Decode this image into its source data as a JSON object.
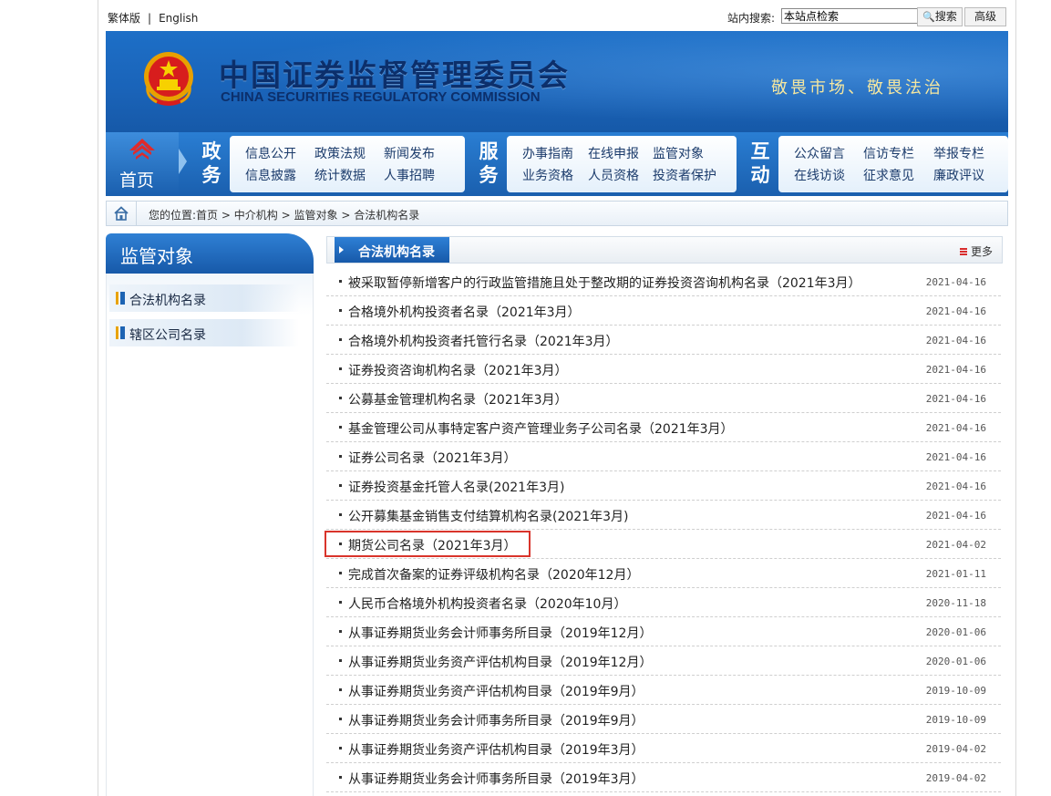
{
  "topbar": {
    "traditional": "繁体版",
    "separator": "|",
    "english": "English",
    "search_label": "站内搜索:",
    "search_value": "本站点检索",
    "search_button": "搜索",
    "advanced_button": "高级"
  },
  "banner": {
    "cn_title": "中国证券监督管理委员会",
    "en_title": "CHINA SECURITIES REGULATORY COMMISSION",
    "slogan": "敬畏市场、敬畏法治"
  },
  "nav": {
    "home": "首页",
    "groups": [
      {
        "t1": "政",
        "t2": "务",
        "links": [
          "信息公开",
          "政策法规",
          "新闻发布",
          "信息披露",
          "统计数据",
          "人事招聘"
        ]
      },
      {
        "t1": "服",
        "t2": "务",
        "links": [
          "办事指南",
          "在线申报",
          "监管对象",
          "业务资格",
          "人员资格",
          "投资者保护"
        ]
      },
      {
        "t1": "互",
        "t2": "动",
        "links": [
          "公众留言",
          "信访专栏",
          "举报专栏",
          "在线访谈",
          "征求意见",
          "廉政评议"
        ]
      }
    ]
  },
  "breadcrumb": {
    "prefix": "您的位置:",
    "items": [
      "首页",
      "中介机构",
      "监管对象",
      "合法机构名录"
    ],
    "sep": ">"
  },
  "sidebar": {
    "title": "监管对象",
    "items": [
      "合法机构名录",
      "辖区公司名录"
    ]
  },
  "main": {
    "tab_title": "合法机构名录",
    "more": "更多",
    "items": [
      {
        "title": "被采取暂停新增客户的行政监管措施且处于整改期的证券投资咨询机构名录（2021年3月）",
        "date": "2021-04-16"
      },
      {
        "title": "合格境外机构投资者名录（2021年3月）",
        "date": "2021-04-16"
      },
      {
        "title": "合格境外机构投资者托管行名录（2021年3月）",
        "date": "2021-04-16"
      },
      {
        "title": "证券投资咨询机构名录（2021年3月）",
        "date": "2021-04-16"
      },
      {
        "title": "公募基金管理机构名录（2021年3月）",
        "date": "2021-04-16"
      },
      {
        "title": "基金管理公司从事特定客户资产管理业务子公司名录（2021年3月）",
        "date": "2021-04-16"
      },
      {
        "title": "证券公司名录（2021年3月）",
        "date": "2021-04-16"
      },
      {
        "title": "证券投资基金托管人名录(2021年3月)",
        "date": "2021-04-16"
      },
      {
        "title": "公开募集基金销售支付结算机构名录(2021年3月)",
        "date": "2021-04-16"
      },
      {
        "title": "期货公司名录（2021年3月）",
        "date": "2021-04-02"
      },
      {
        "title": "完成首次备案的证券评级机构名录（2020年12月）",
        "date": "2021-01-11"
      },
      {
        "title": "人民币合格境外机构投资者名录（2020年10月）",
        "date": "2020-11-18"
      },
      {
        "title": "从事证券期货业务会计师事务所目录（2019年12月）",
        "date": "2020-01-06"
      },
      {
        "title": "从事证券期货业务资产评估机构目录（2019年12月）",
        "date": "2020-01-06"
      },
      {
        "title": "从事证券期货业务资产评估机构目录（2019年9月）",
        "date": "2019-10-09"
      },
      {
        "title": "从事证券期货业务会计师事务所目录（2019年9月）",
        "date": "2019-10-09"
      },
      {
        "title": "从事证券期货业务资产评估机构目录（2019年3月）",
        "date": "2019-04-02"
      },
      {
        "title": "从事证券期货业务会计师事务所目录（2019年3月）",
        "date": "2019-04-02"
      }
    ]
  },
  "colors": {
    "brand_blue": "#1a63b8",
    "highlight_red": "#d9342b",
    "slogan_gold": "#f5e7a0"
  }
}
